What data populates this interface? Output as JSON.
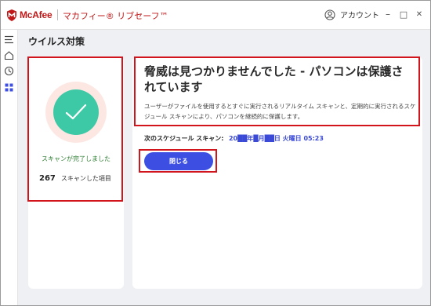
{
  "app": {
    "brand": "McAfee",
    "name": "マカフィー® リブセーフ™"
  },
  "titlebar": {
    "account_label": "アカウント",
    "minimize_glyph": "–",
    "maximize_glyph": "□",
    "close_glyph": "✕"
  },
  "sidebar": {
    "icons": [
      "menu-icon",
      "home-icon",
      "privacy-icon",
      "apps-grid-icon"
    ]
  },
  "page": {
    "title": "ウイルス対策"
  },
  "scan_result": {
    "status": "スキャンが完了しました",
    "scanned_count": "267",
    "scanned_label": "スキャンした項目",
    "headline": "脅威は見つかりませんでした - パソコンは保護されています",
    "description": "ユーザーがファイルを使用するとすぐに実行されるリアルタイム スキャンと、定期的に実行されるスケジュール スキャンにより、パソコンを継続的に保護します。",
    "next_scan_label": "次のスケジュール スキャン:",
    "next_scan_value": "20██年█月██日 火曜日 05:23",
    "close_label": "閉じる"
  },
  "colors": {
    "brand_red": "#c01818",
    "accent_blue": "#3d4fe2",
    "check_green": "#3ec9a6",
    "highlight_red": "#d2151d"
  }
}
